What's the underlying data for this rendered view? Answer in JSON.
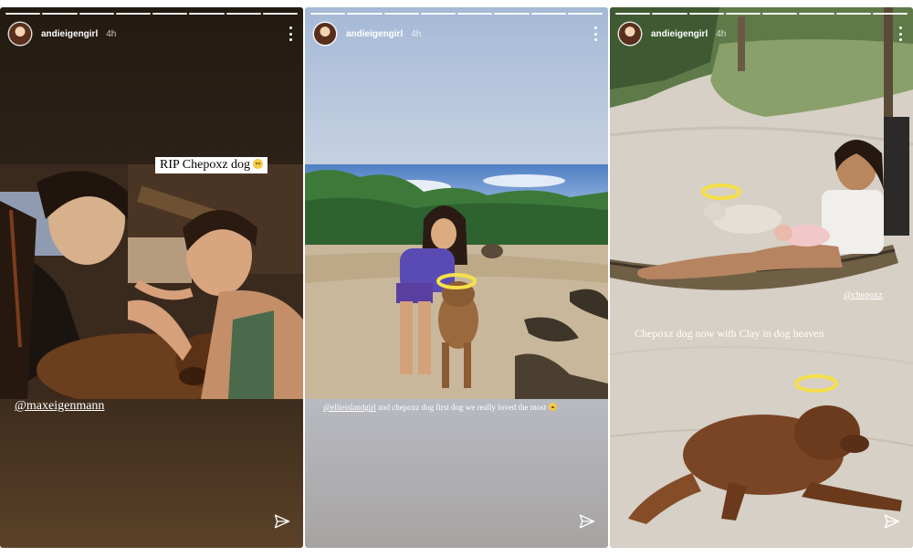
{
  "stories": [
    {
      "username": "andieigengirl",
      "time": "4h",
      "progress": {
        "segments": 8,
        "viewed": 8
      },
      "sticker_text": "RIP Chepoxz dog",
      "mention": "@maxeigenmann"
    },
    {
      "username": "andieigengirl",
      "time": "4h",
      "progress": {
        "segments": 8,
        "viewed": 8
      },
      "mention": "@ellieislandgirl",
      "caption": "and chepoxz dog first dog we really loved the most"
    },
    {
      "username": "andieigengirl",
      "time": "4h",
      "progress": {
        "segments": 8,
        "viewed": 8
      },
      "mention": "@chepoxz",
      "caption": "Chepoxz dog now with Clay in dog heaven"
    }
  ],
  "icons": {
    "more": "more-vertical-icon",
    "send": "send-paper-plane-icon",
    "halo": "halo-sticker",
    "emoji": "sad-face-emoji"
  },
  "colors": {
    "story1_bg": "#2c2117",
    "story2_bg": "#c7d2e2",
    "story3_bg": "#d8d2c8",
    "halo": "#f5e04a"
  }
}
